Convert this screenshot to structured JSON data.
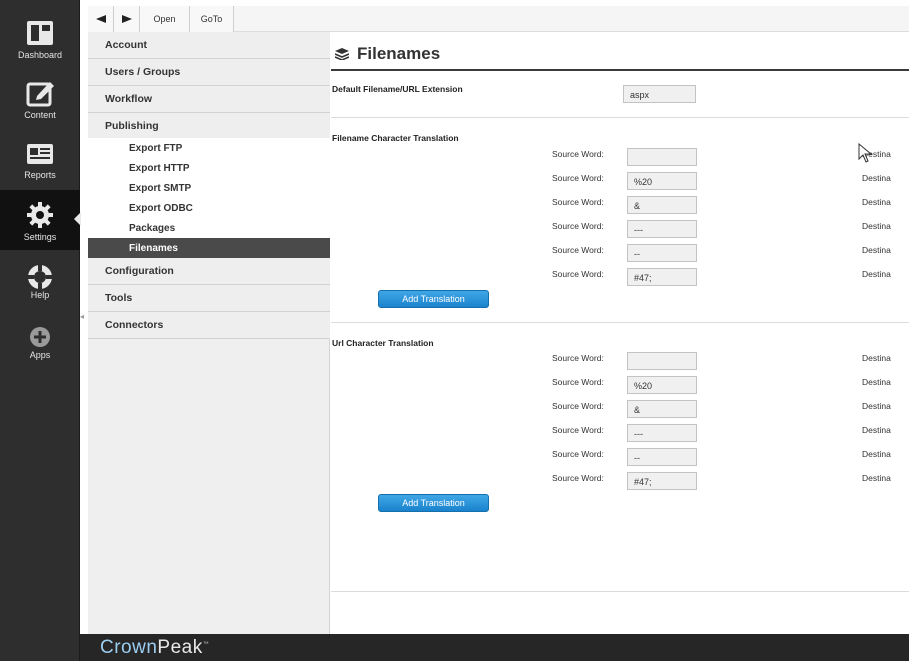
{
  "rail": [
    {
      "label": "Dashboard",
      "icon": "dashboard-icon"
    },
    {
      "label": "Content",
      "icon": "edit-icon"
    },
    {
      "label": "Reports",
      "icon": "reports-icon"
    },
    {
      "label": "Settings",
      "icon": "gear-icon"
    },
    {
      "label": "Help",
      "icon": "help-lifebuoy-icon"
    },
    {
      "label": "Apps",
      "icon": "plus-circle-icon"
    }
  ],
  "toolbar": {
    "open": "Open",
    "goto": "GoTo"
  },
  "nav": {
    "top": [
      "Account",
      "Users / Groups",
      "Workflow",
      "Publishing"
    ],
    "sub": [
      "Export FTP",
      "Export HTTP",
      "Export SMTP",
      "Export ODBC",
      "Packages",
      "Filenames"
    ],
    "bottom": [
      "Configuration",
      "Tools",
      "Connectors"
    ]
  },
  "main": {
    "title": "Filenames",
    "default_ext_label": "Default Filename/URL Extension",
    "default_ext_value": "aspx",
    "source_label": "Source Word:",
    "dest_label": "Destina",
    "filename_section": "Filename Character Translation",
    "filename_values": [
      "",
      "%20",
      "&",
      "---",
      "--",
      "#47;"
    ],
    "url_section": "Url Character Translation",
    "url_values": [
      "",
      "%20",
      "&",
      "---",
      "--",
      "#47;"
    ],
    "add_button": "Add Translation"
  },
  "footer": {
    "brand_a": "Crown",
    "brand_b": "Peak",
    "brand_tm": "™"
  }
}
